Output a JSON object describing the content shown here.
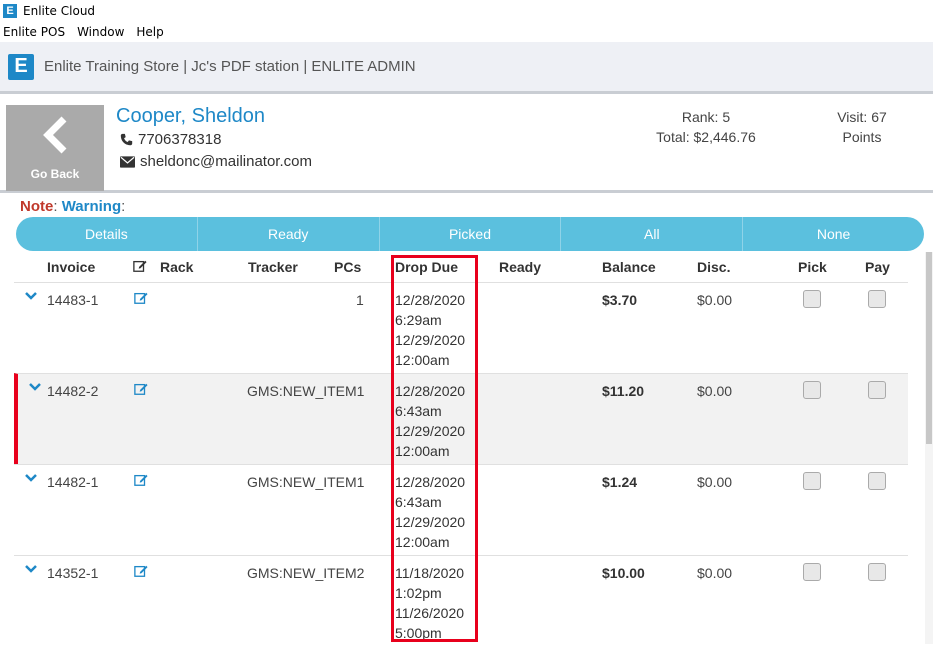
{
  "window": {
    "title": "Enlite Cloud"
  },
  "menu": [
    "Enlite POS",
    "Window",
    "Help"
  ],
  "appbar": {
    "store": "Enlite Training Store | Jc's PDF station | ENLITE ADMIN"
  },
  "customer": {
    "go_back": "Go Back",
    "name": "Cooper, Sheldon",
    "phone": "7706378318",
    "email": "sheldonc@mailinator.com",
    "rank": "Rank: 5",
    "total": "Total: $2,446.76",
    "visit": "Visit: 67",
    "points": "Points"
  },
  "note": {
    "label": "Note",
    "sep": ": ",
    "warning": "Warning",
    "end": ":"
  },
  "filters": [
    "Details",
    "Ready",
    "Picked",
    "All",
    "None"
  ],
  "headers": {
    "invoice": "Invoice",
    "rack": "Rack",
    "tracker": "Tracker",
    "pcs": "PCs",
    "drop_due": "Drop Due",
    "ready": "Ready",
    "balance": "Balance",
    "disc": "Disc.",
    "pick": "Pick",
    "pay": "Pay"
  },
  "rows": [
    {
      "invoice": "14483-1",
      "tracker": "",
      "pcs": "1",
      "drop_date": "12/28/2020",
      "drop_time": "6:29am",
      "due_date": "12/29/2020",
      "due_time": "12:00am",
      "balance": "$3.70",
      "disc": "$0.00"
    },
    {
      "invoice": "14482-2",
      "tracker": "GMS:NEW_ITEM1",
      "pcs": "",
      "drop_date": "12/28/2020",
      "drop_time": "6:43am",
      "due_date": "12/29/2020",
      "due_time": "12:00am",
      "balance": "$11.20",
      "disc": "$0.00"
    },
    {
      "invoice": "14482-1",
      "tracker": "GMS:NEW_ITEM1",
      "pcs": "",
      "drop_date": "12/28/2020",
      "drop_time": "6:43am",
      "due_date": "12/29/2020",
      "due_time": "12:00am",
      "balance": "$1.24",
      "disc": "$0.00"
    },
    {
      "invoice": "14352-1",
      "tracker": "GMS:NEW_ITEM2",
      "pcs": "",
      "drop_date": "11/18/2020",
      "drop_time": "1:02pm",
      "due_date": "11/26/2020",
      "due_time": "5:00pm",
      "balance": "$10.00",
      "disc": "$0.00"
    }
  ],
  "colors": {
    "accent": "#1e88c7",
    "filter_bar": "#5bc0de",
    "note": "#c0392b",
    "highlight": "#e8001c"
  }
}
